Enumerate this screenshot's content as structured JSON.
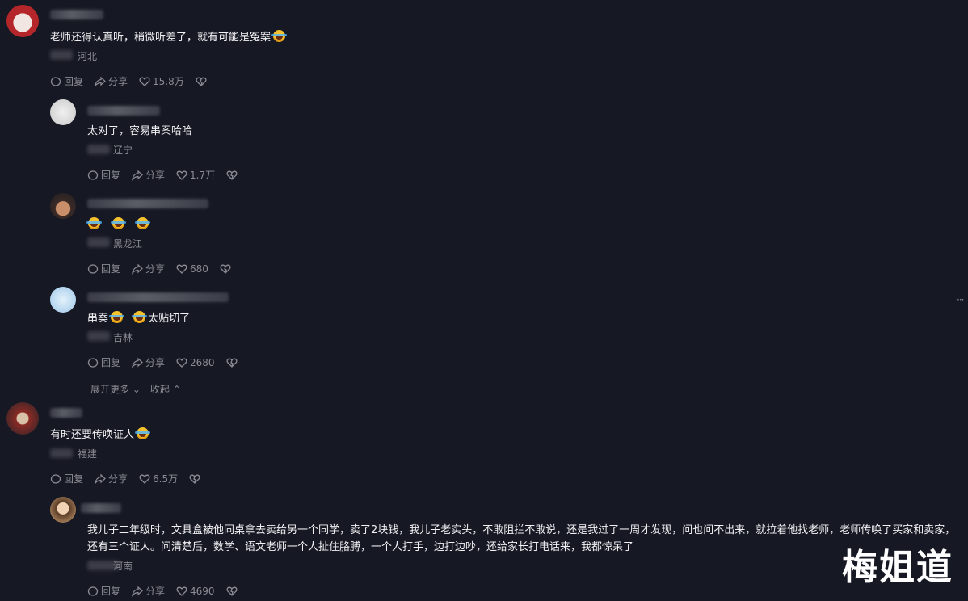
{
  "actions": {
    "reply": "回复",
    "share": "分享"
  },
  "comments": [
    {
      "text": "老师还得认真听，稍微听差了，就有可能是冤案",
      "location": "河北",
      "likes": "15.8万"
    },
    {
      "text": "太对了，容易串案哈哈",
      "location": "辽宁",
      "likes": "1.7万"
    },
    {
      "text": "",
      "location": "黑龙江",
      "likes": "680"
    },
    {
      "text_a": "串案",
      "text_b": "太贴切了",
      "location": "吉林",
      "likes": "2680"
    },
    {
      "text": "有时还要传唤证人",
      "location": "福建",
      "likes": "6.5万"
    },
    {
      "text": "我儿子二年级时，文具盒被他同桌拿去卖给另一个同学，卖了2块钱，我儿子老实头，不敢阻拦不敢说，还是我过了一周才发现，问也问不出来，就拉着他找老师，老师传唤了买家和卖家，还有三个证人。问清楚后，数学、语文老师一个人扯住胳膊，一个人打手，边打边吵，还给家长打电话来，我都惊呆了",
      "location": "河南",
      "likes": "4690"
    }
  ],
  "expand": {
    "more": "展开更多",
    "collapse": "收起"
  },
  "watermark": "梅姐道",
  "icons": [
    "reply-icon",
    "share-icon",
    "like-icon",
    "dislike-icon",
    "chevron-down-icon",
    "chevron-up-icon"
  ],
  "colors": {
    "background": "#161823",
    "text": "#f2f2f4",
    "muted": "#8a8b93"
  }
}
